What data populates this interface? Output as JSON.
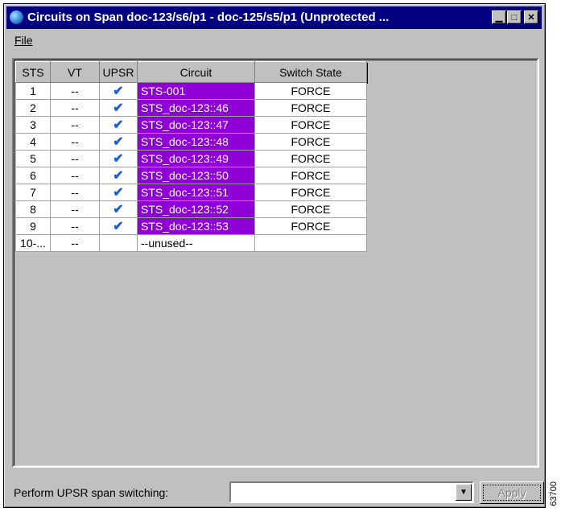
{
  "window": {
    "title": "Circuits on Span doc-123/s6/p1 - doc-125/s5/p1 (Unprotected ...",
    "min_label": "▁",
    "max_label": "□",
    "close_label": "✕"
  },
  "menu": {
    "file_label": "File"
  },
  "table": {
    "headers": [
      "STS",
      "VT",
      "UPSR",
      "Circuit",
      "Switch State"
    ],
    "rows": [
      {
        "sts": "1",
        "vt": "--",
        "upsr": "✔",
        "circuit": "STS-001",
        "switch": "FORCE"
      },
      {
        "sts": "2",
        "vt": "--",
        "upsr": "✔",
        "circuit": "STS_doc-123::46",
        "switch": "FORCE"
      },
      {
        "sts": "3",
        "vt": "--",
        "upsr": "✔",
        "circuit": "STS_doc-123::47",
        "switch": "FORCE"
      },
      {
        "sts": "4",
        "vt": "--",
        "upsr": "✔",
        "circuit": "STS_doc-123::48",
        "switch": "FORCE"
      },
      {
        "sts": "5",
        "vt": "--",
        "upsr": "✔",
        "circuit": "STS_doc-123::49",
        "switch": "FORCE"
      },
      {
        "sts": "6",
        "vt": "--",
        "upsr": "✔",
        "circuit": "STS_doc-123::50",
        "switch": "FORCE"
      },
      {
        "sts": "7",
        "vt": "--",
        "upsr": "✔",
        "circuit": "STS_doc-123::51",
        "switch": "FORCE"
      },
      {
        "sts": "8",
        "vt": "--",
        "upsr": "✔",
        "circuit": "STS_doc-123::52",
        "switch": "FORCE"
      },
      {
        "sts": "9",
        "vt": "--",
        "upsr": "✔",
        "circuit": "STS_doc-123::53",
        "switch": "FORCE"
      },
      {
        "sts": "10-...",
        "vt": "--",
        "upsr": "",
        "circuit": "--unused--",
        "switch": ""
      }
    ]
  },
  "footer": {
    "switch_label": "Perform UPSR span switching:",
    "combo_value": "",
    "apply_label": "Apply",
    "figure_id": "63700"
  },
  "colors": {
    "titlebar": "#000080",
    "selected_circuit": "#8e00d6",
    "check": "#1e5fd0"
  },
  "icons": {
    "app": "globe-icon",
    "check": "checkmark-icon",
    "combo": "chevron-down-icon"
  }
}
